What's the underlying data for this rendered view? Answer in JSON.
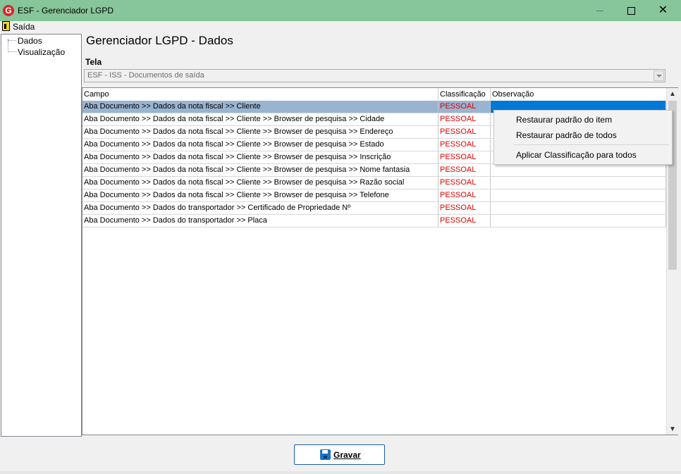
{
  "window": {
    "title": "ESF - Gerenciador LGPD",
    "app_icon": "G"
  },
  "menu": {
    "exit_label": "Saída"
  },
  "tree": {
    "items": [
      "Dados",
      "Visualização"
    ]
  },
  "header": {
    "title": "Gerenciador LGPD - Dados"
  },
  "tela": {
    "label": "Tela",
    "value": "ESF - ISS - Documentos de saída"
  },
  "grid": {
    "columns": [
      "Campo",
      "Classificação",
      "Observação"
    ],
    "rows": [
      {
        "campo": "Aba Documento >> Dados da nota fiscal >> Cliente",
        "classificacao": "PESSOAL",
        "observacao": ""
      },
      {
        "campo": "Aba Documento >> Dados da nota fiscal >> Cliente >> Browser de pesquisa >> Cidade",
        "classificacao": "PESSOAL",
        "observacao": ""
      },
      {
        "campo": "Aba Documento >> Dados da nota fiscal >> Cliente >> Browser de pesquisa >> Endereço",
        "classificacao": "PESSOAL",
        "observacao": ""
      },
      {
        "campo": "Aba Documento >> Dados da nota fiscal >> Cliente >> Browser de pesquisa >> Estado",
        "classificacao": "PESSOAL",
        "observacao": ""
      },
      {
        "campo": "Aba Documento >> Dados da nota fiscal >> Cliente >> Browser de pesquisa >> Inscrição",
        "classificacao": "PESSOAL",
        "observacao": ""
      },
      {
        "campo": "Aba Documento >> Dados da nota fiscal >> Cliente >> Browser de pesquisa >> Nome fantasia",
        "classificacao": "PESSOAL",
        "observacao": ""
      },
      {
        "campo": "Aba Documento >> Dados da nota fiscal >> Cliente >> Browser de pesquisa >> Razão social",
        "classificacao": "PESSOAL",
        "observacao": ""
      },
      {
        "campo": "Aba Documento >> Dados da nota fiscal >> Cliente >> Browser de pesquisa >> Telefone",
        "classificacao": "PESSOAL",
        "observacao": ""
      },
      {
        "campo": "Aba Documento >> Dados do transportador >> Certificado de Propriedade Nº",
        "classificacao": "PESSOAL",
        "observacao": ""
      },
      {
        "campo": "Aba Documento >> Dados do transportador >> Placa",
        "classificacao": "PESSOAL",
        "observacao": ""
      }
    ]
  },
  "context_menu": {
    "items": [
      "Restaurar padrão do item",
      "Restaurar padrão de todos",
      "Aplicar Classificação para todos"
    ]
  },
  "footer": {
    "save_label": "Gravar"
  },
  "colors": {
    "titlebar": "#87c59a",
    "selection": "#99b4d1",
    "classification": "#e00000",
    "active_cell": "#0078d7"
  }
}
